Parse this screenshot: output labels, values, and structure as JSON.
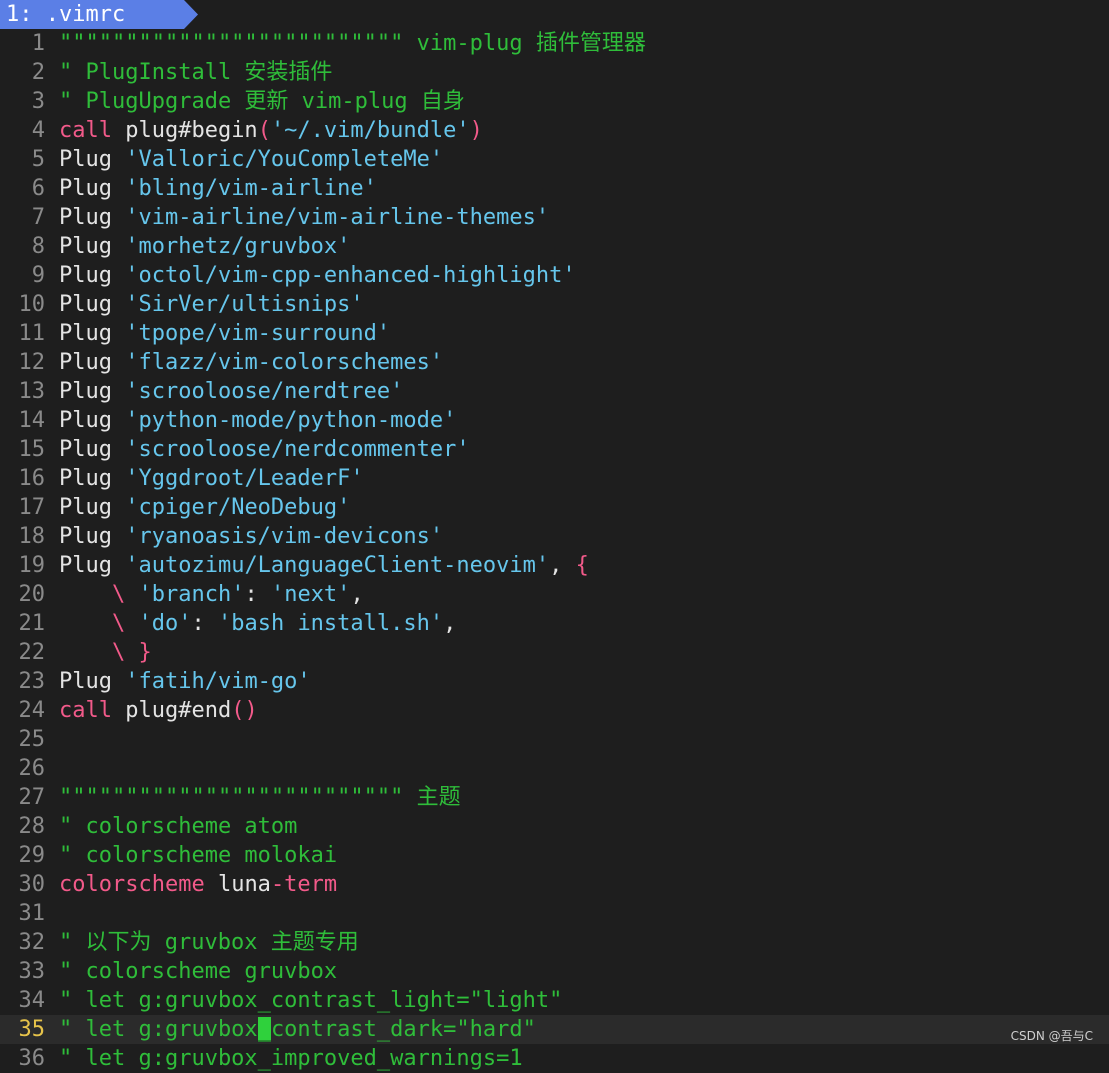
{
  "tabline": {
    "tab_label": "1: .vimrc"
  },
  "lines": [
    {
      "n": "1",
      "segs": [
        [
          "c",
          "\"\"\"\"\"\"\"\"\"\"\"\"\"\"\"\"\"\"\"\"\"\"\"\"\"\" vim-plug 插件管理器"
        ]
      ]
    },
    {
      "n": "2",
      "segs": [
        [
          "c",
          "\" PlugInstall 安装插件"
        ]
      ]
    },
    {
      "n": "3",
      "segs": [
        [
          "c",
          "\" PlugUpgrade 更新 vim-plug 自身"
        ]
      ]
    },
    {
      "n": "4",
      "segs": [
        [
          "k",
          "call"
        ],
        [
          "p",
          " plug#begin"
        ],
        [
          "k",
          "("
        ],
        [
          "s",
          "'~/.vim/bundle'"
        ],
        [
          "k",
          ")"
        ]
      ]
    },
    {
      "n": "5",
      "segs": [
        [
          "p",
          "Plug "
        ],
        [
          "s",
          "'Valloric/YouCompleteMe'"
        ]
      ]
    },
    {
      "n": "6",
      "segs": [
        [
          "p",
          "Plug "
        ],
        [
          "s",
          "'bling/vim-airline'"
        ]
      ]
    },
    {
      "n": "7",
      "segs": [
        [
          "p",
          "Plug "
        ],
        [
          "s",
          "'vim-airline/vim-airline-themes'"
        ]
      ]
    },
    {
      "n": "8",
      "segs": [
        [
          "p",
          "Plug "
        ],
        [
          "s",
          "'morhetz/gruvbox'"
        ]
      ]
    },
    {
      "n": "9",
      "segs": [
        [
          "p",
          "Plug "
        ],
        [
          "s",
          "'octol/vim-cpp-enhanced-highlight'"
        ]
      ]
    },
    {
      "n": "10",
      "segs": [
        [
          "p",
          "Plug "
        ],
        [
          "s",
          "'SirVer/ultisnips'"
        ]
      ]
    },
    {
      "n": "11",
      "segs": [
        [
          "p",
          "Plug "
        ],
        [
          "s",
          "'tpope/vim-surround'"
        ]
      ]
    },
    {
      "n": "12",
      "segs": [
        [
          "p",
          "Plug "
        ],
        [
          "s",
          "'flazz/vim-colorschemes'"
        ]
      ]
    },
    {
      "n": "13",
      "segs": [
        [
          "p",
          "Plug "
        ],
        [
          "s",
          "'scrooloose/nerdtree'"
        ]
      ]
    },
    {
      "n": "14",
      "segs": [
        [
          "p",
          "Plug "
        ],
        [
          "s",
          "'python-mode/python-mode'"
        ]
      ]
    },
    {
      "n": "15",
      "segs": [
        [
          "p",
          "Plug "
        ],
        [
          "s",
          "'scrooloose/nerdcommenter'"
        ]
      ]
    },
    {
      "n": "16",
      "segs": [
        [
          "p",
          "Plug "
        ],
        [
          "s",
          "'Yggdroot/LeaderF'"
        ]
      ]
    },
    {
      "n": "17",
      "segs": [
        [
          "p",
          "Plug "
        ],
        [
          "s",
          "'cpiger/NeoDebug'"
        ]
      ]
    },
    {
      "n": "18",
      "segs": [
        [
          "p",
          "Plug "
        ],
        [
          "s",
          "'ryanoasis/vim-devicons'"
        ]
      ]
    },
    {
      "n": "19",
      "segs": [
        [
          "p",
          "Plug "
        ],
        [
          "s",
          "'autozimu/LanguageClient-neovim'"
        ],
        [
          "p",
          ", "
        ],
        [
          "k",
          "{"
        ]
      ]
    },
    {
      "n": "20",
      "segs": [
        [
          "p",
          "    "
        ],
        [
          "k",
          "\\"
        ],
        [
          "p",
          " "
        ],
        [
          "s",
          "'branch'"
        ],
        [
          "p",
          ": "
        ],
        [
          "s",
          "'next'"
        ],
        [
          "p",
          ","
        ]
      ]
    },
    {
      "n": "21",
      "segs": [
        [
          "p",
          "    "
        ],
        [
          "k",
          "\\"
        ],
        [
          "p",
          " "
        ],
        [
          "s",
          "'do'"
        ],
        [
          "p",
          ": "
        ],
        [
          "s",
          "'bash install.sh'"
        ],
        [
          "p",
          ","
        ]
      ]
    },
    {
      "n": "22",
      "segs": [
        [
          "p",
          "    "
        ],
        [
          "k",
          "\\ }"
        ]
      ]
    },
    {
      "n": "23",
      "segs": [
        [
          "p",
          "Plug "
        ],
        [
          "s",
          "'fatih/vim-go'"
        ]
      ]
    },
    {
      "n": "24",
      "segs": [
        [
          "k",
          "call"
        ],
        [
          "p",
          " plug#end"
        ],
        [
          "k",
          "()"
        ]
      ]
    },
    {
      "n": "25",
      "segs": []
    },
    {
      "n": "26",
      "segs": []
    },
    {
      "n": "27",
      "segs": [
        [
          "c",
          "\"\"\"\"\"\"\"\"\"\"\"\"\"\"\"\"\"\"\"\"\"\"\"\"\"\" 主题"
        ]
      ]
    },
    {
      "n": "28",
      "segs": [
        [
          "c",
          "\" colorscheme atom"
        ]
      ]
    },
    {
      "n": "29",
      "segs": [
        [
          "c",
          "\" colorscheme molokai"
        ]
      ]
    },
    {
      "n": "30",
      "segs": [
        [
          "k",
          "colorscheme"
        ],
        [
          "p",
          " luna"
        ],
        [
          "k",
          "-term"
        ]
      ]
    },
    {
      "n": "31",
      "segs": []
    },
    {
      "n": "32",
      "segs": [
        [
          "c",
          "\" 以下为 gruvbox 主题专用"
        ]
      ]
    },
    {
      "n": "33",
      "segs": [
        [
          "c",
          "\" colorscheme gruvbox"
        ]
      ]
    },
    {
      "n": "34",
      "segs": [
        [
          "c",
          "\" let g:gruvbox_contrast_light=\"light\""
        ]
      ]
    },
    {
      "n": "35",
      "current": true,
      "segs": [
        [
          "c",
          "\" let g:gruvbox"
        ],
        [
          "cursor",
          "_"
        ],
        [
          "c",
          "contrast_dark=\"hard\""
        ]
      ]
    },
    {
      "n": "36",
      "segs": [
        [
          "c",
          "\" let g:gruvbox_improved_warnings=1"
        ]
      ]
    }
  ],
  "watermark": "CSDN @吾与C",
  "colors": {
    "comment": "#2fbd3a",
    "keyword": "#f25a8a",
    "string": "#66c6ec",
    "text": "#e4e4e4",
    "line_number": "#8a8a8a",
    "current_line_number": "#e6c34a",
    "tab_background": "#5b7fe6",
    "background": "#1e1e1e"
  }
}
